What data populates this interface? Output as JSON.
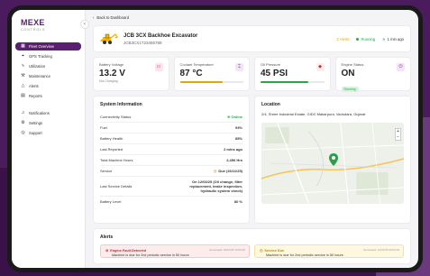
{
  "sidebar": {
    "logo_main": "MEXE",
    "logo_sub": "CONTROLS",
    "items": [
      {
        "label": "Fleet Overview",
        "icon": "grid-icon"
      },
      {
        "label": "GPS Tracking",
        "icon": "pin-icon"
      },
      {
        "label": "Utilization",
        "icon": "trend-icon"
      },
      {
        "label": "Maintenance",
        "icon": "wrench-icon"
      },
      {
        "label": "Alerts",
        "icon": "warning-icon"
      },
      {
        "label": "Reports",
        "icon": "document-icon"
      }
    ],
    "bottom_items": [
      {
        "label": "Notifications",
        "icon": "bell-icon"
      },
      {
        "label": "Settings",
        "icon": "gear-icon"
      },
      {
        "label": "Support",
        "icon": "help-icon"
      }
    ]
  },
  "breadcrumb": {
    "back_label": "Back to Dashboard"
  },
  "vehicle": {
    "title": "JCB 3CX Backhoe Excavator",
    "id": "JCB3CX1T23456789",
    "alerts": "2 Alerts",
    "status": "Running",
    "last_update": "1 min ago"
  },
  "metrics": [
    {
      "label": "Battery Voltage",
      "value": "13.2 V",
      "sub": "Not Charging",
      "color": "#c2185b",
      "bg": "#fce4ec"
    },
    {
      "label": "Coolant Temperature",
      "value": "87 °C",
      "color": "#7b1fa2",
      "bg": "#f3e5f5",
      "bar_pct": 0.68,
      "bar_color": "#e0a800"
    },
    {
      "label": "Oil Pressure",
      "value": "45 PSI",
      "color": "#c62828",
      "bg": "#fdecec",
      "bar_pct": 0.75,
      "bar_color": "#28a745"
    },
    {
      "label": "Engine Status",
      "value": "ON",
      "chip": "Running",
      "color": "#7b1fa2",
      "bg": "#f3e5f5"
    }
  ],
  "system_info": {
    "title": "System Information",
    "rows": [
      {
        "label": "Connectivity Status",
        "value": "Online"
      },
      {
        "label": "Fuel",
        "value": "93%"
      },
      {
        "label": "Battery Health",
        "value": "85%"
      },
      {
        "label": "Last Reported",
        "value": "2 mins ago"
      },
      {
        "label": "Total Machine Hours",
        "value": "2,456 Hrs"
      },
      {
        "label": "Service",
        "value": "Due (26/11/25)"
      },
      {
        "label": "Last Service Details",
        "value": "On 12/03/25 (Oil change, filter replacement, brake inspection, hydraulic system check)"
      },
      {
        "label": "Battery Level",
        "value": "80 %"
      }
    ]
  },
  "location": {
    "title": "Location",
    "address": "2/4, Shree Industrial Estate, GIDC Makarpura, Vadodara, Gujarat"
  },
  "alerts": {
    "title": "Alerts",
    "items": [
      {
        "title": "Engine Fault Detected",
        "message": "Machine is due for 2nd periodic service in 50 hours",
        "time": "Generated: 18/07/25 12:00:00",
        "level": "red"
      },
      {
        "title": "Service Due",
        "message": "Machine is due for 2nd periodic service in 50 hours",
        "time": "Generated: 12/07/25 09:00:00",
        "level": "yellow"
      }
    ]
  }
}
